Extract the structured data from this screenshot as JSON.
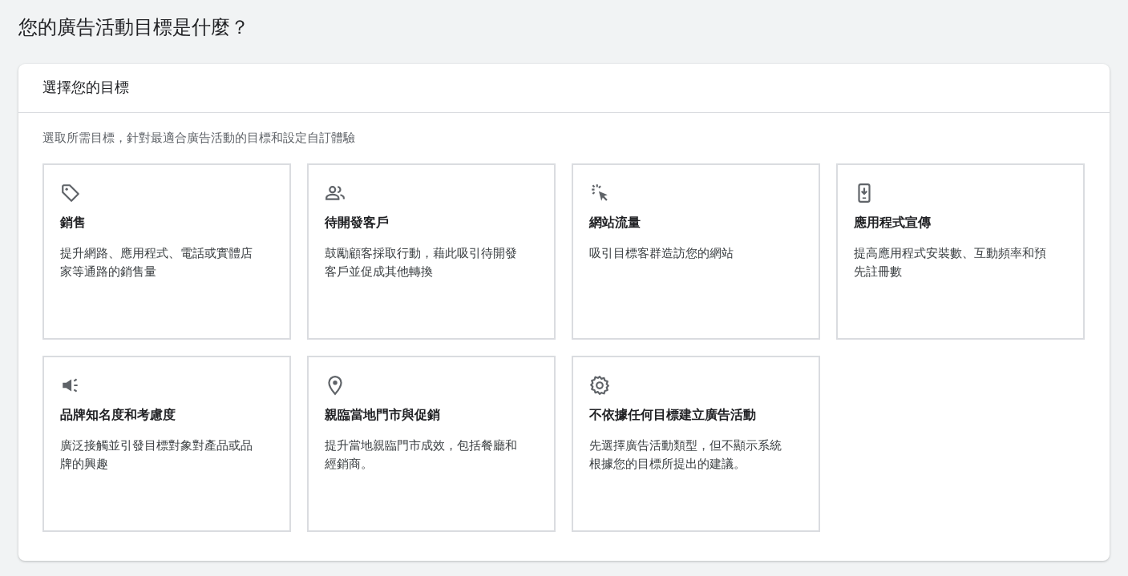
{
  "page_title": "您的廣告活動目標是什麼？",
  "panel": {
    "title": "選擇您的目標",
    "subtitle": "選取所需目標，針對最適合廣告活動的目標和設定自訂體驗",
    "goals": [
      {
        "title": "銷售",
        "description": "提升網路、應用程式、電話或實體店家等通路的銷售量"
      },
      {
        "title": "待開發客戶",
        "description": "鼓勵顧客採取行動，藉此吸引待開發客戶並促成其他轉換"
      },
      {
        "title": "網站流量",
        "description": "吸引目標客群造訪您的網站"
      },
      {
        "title": "應用程式宣傳",
        "description": "提高應用程式安裝數、互動頻率和預先註冊數"
      },
      {
        "title": "品牌知名度和考慮度",
        "description": "廣泛接觸並引發目標對象對產品或品牌的興趣"
      },
      {
        "title": "親臨當地門市與促銷",
        "description": "提升當地親臨門市成效，包括餐廳和經銷商。"
      },
      {
        "title": "不依據任何目標建立廣告活動",
        "description": "先選擇廣告活動類型，但不顯示系統根據您的目標所提出的建議。"
      }
    ]
  }
}
